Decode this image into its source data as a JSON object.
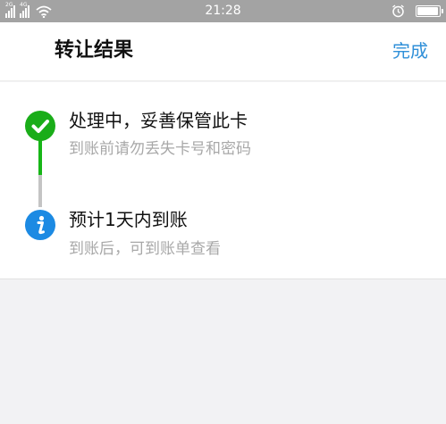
{
  "status_bar": {
    "time": "21:28",
    "sim1_net": "2G",
    "sim2_net": "4G",
    "icons": [
      "signal-icon",
      "signal-icon",
      "wifi-icon",
      "alarm-icon",
      "battery-icon"
    ],
    "battery_level": 0.95
  },
  "header": {
    "title": "转让结果",
    "done_label": "完成"
  },
  "steps": [
    {
      "title": "处理中，妥善保管此卡",
      "subtitle": "到账前请勿丢失卡号和密码",
      "icon": "check-circle-icon",
      "color": "#1aad19"
    },
    {
      "title": "预计1天内到账",
      "subtitle": "到账后，可到账单查看",
      "icon": "info-circle-icon",
      "color": "#1c8ae3"
    }
  ],
  "colors": {
    "accent": "#2f8fd8",
    "success": "#1aad19",
    "info": "#1c8ae3",
    "status_bar": "#a3a3a3"
  }
}
